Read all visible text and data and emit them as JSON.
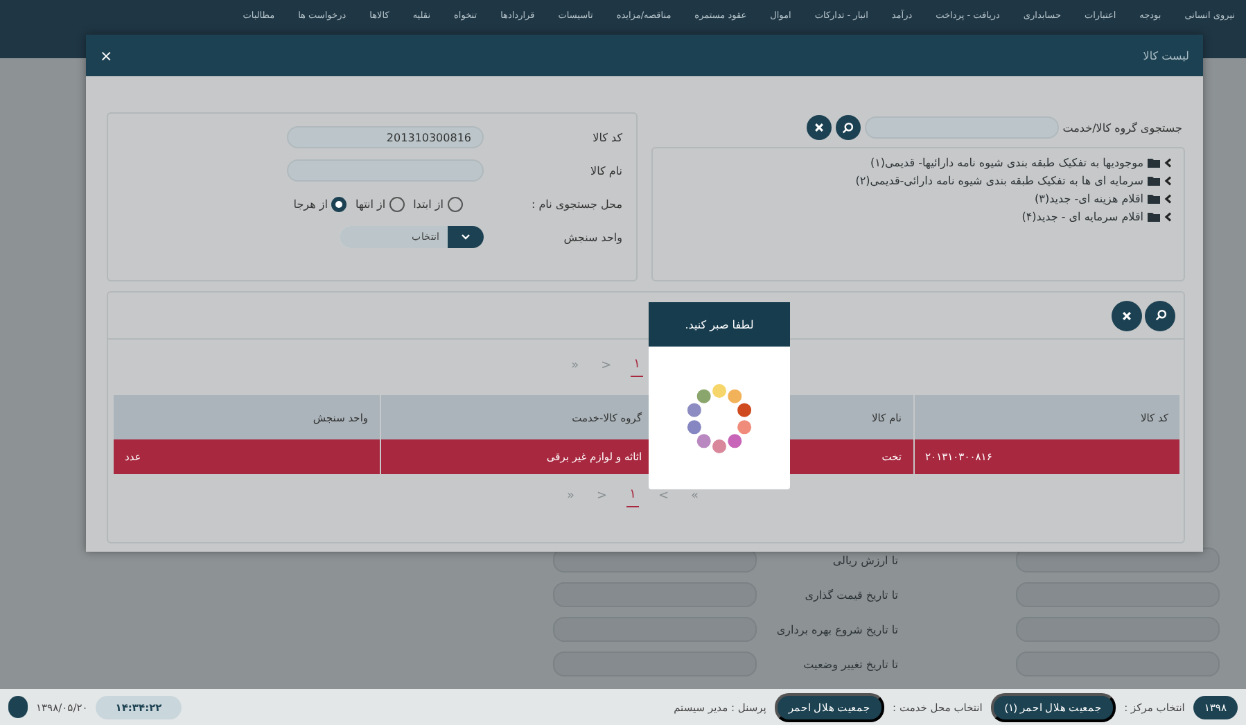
{
  "menu": [
    "نیروی انسانی",
    "بودجه",
    "اعتبارات",
    "حسابداری",
    "دریافت - پرداخت",
    "درآمد",
    "انبار - تدارکات",
    "اموال",
    "عقود مستمره",
    "مناقصه/مزایده",
    "تاسیسات",
    "قراردادها",
    "تنخواه",
    "نقلیه",
    "کالاها",
    "درخواست ها",
    "مطالبات"
  ],
  "background_form": [
    {
      "label": "تا ارزش ریالی"
    },
    {
      "label": "تا تاریخ قیمت گذاری"
    },
    {
      "label": "تا تاریخ شروع بهره برداری"
    },
    {
      "label": "تا تاریخ تغییر وضعیت"
    }
  ],
  "status_bar": {
    "year": "۱۳۹۸",
    "center_label": "انتخاب مرکز :",
    "center": "جمعیت هلال احمر (۱)",
    "service_label": "انتخاب محل خدمت :",
    "service": "جمعیت هلال احمر",
    "user": "پرسنل : مدیر سیستم",
    "time": "۱۴:۳۴:۲۲",
    "date": "۱۳۹۸/۰۵/۲۰"
  },
  "dialog": {
    "title": "لیست کالا",
    "close": "×",
    "group_search": {
      "label": "جستجوی گروه کالا/خدمت",
      "tree": [
        {
          "label": "موجودیها به تفکیک طبقه بندی شیوه نامه دارائیها- قدیمی(۱)",
          "expanded": false
        },
        {
          "label": "سرمایه ای ها به تفکیک طبقه بندی شیوه نامه دارائی-قدیمی(۲)",
          "expanded": false
        },
        {
          "label": "اقلام هزینه ای- جدید(۳)",
          "expanded": false
        },
        {
          "label": "اقلام سرمایه ای - جدید(۴)",
          "expanded": false
        }
      ]
    },
    "filters": {
      "code_label": "کد کالا",
      "code_value": "201310300816",
      "name_label": "نام کالا",
      "position_label": "محل جستجوی نام :",
      "positions": [
        {
          "label": "از ابتدا",
          "selected": false
        },
        {
          "label": "از انتها",
          "selected": false
        },
        {
          "label": "از هرجا",
          "selected": true
        }
      ],
      "unit_label": "واحد سنجش",
      "unit_value": "انتخاب"
    },
    "pager_top": [
      {
        "label": "۱",
        "selected": true
      },
      {
        "label": "<",
        "selected": false
      },
      {
        "label": "«",
        "selected": false
      }
    ],
    "table": {
      "columns": [
        "کد کالا",
        "نام کالا",
        "گروه کالا-خدمت",
        "واحد سنجش"
      ],
      "rows": [
        {
          "cells": [
            "۲۰۱۳۱۰۳۰۰۸۱۶",
            "تخت",
            "اثاثه و لوازم غیر برقی",
            "عدد"
          ],
          "selected": true
        }
      ]
    },
    "pager_bottom": [
      {
        "label": "»",
        "selected": false
      },
      {
        "label": ">",
        "selected": false
      },
      {
        "label": "۱",
        "selected": true
      },
      {
        "label": "<",
        "selected": false
      },
      {
        "label": "«",
        "selected": false
      }
    ],
    "loading": {
      "title": "لطفا صبر کنید."
    }
  }
}
